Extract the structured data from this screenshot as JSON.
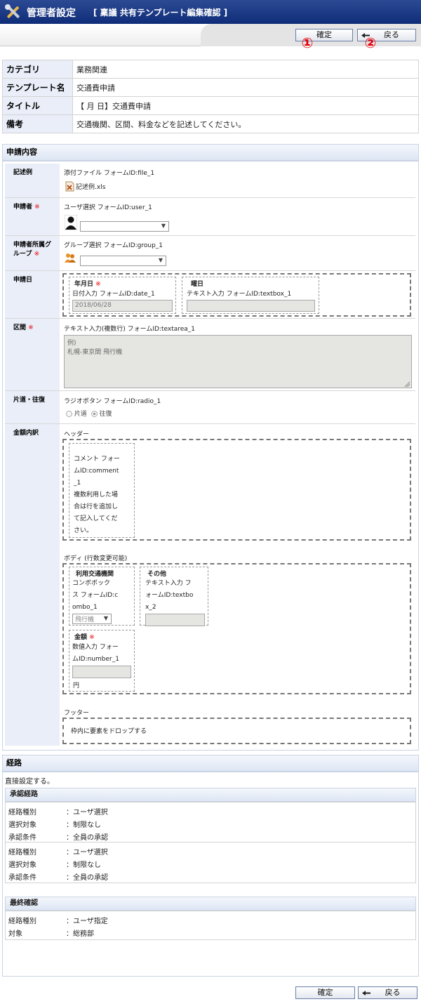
{
  "header": {
    "title": "管理者設定",
    "subtitle": "[ 稟議  共有テンプレート編集確認 ]"
  },
  "buttons": {
    "confirm": "確定",
    "back": "戻る"
  },
  "markers": {
    "one": "①",
    "two": "②"
  },
  "info": {
    "category_label": "カテゴリ",
    "category_value": "業務関連",
    "template_label": "テンプレート名",
    "template_value": "交通費申請",
    "title_label": "タイトル",
    "title_value": "【   月   日】交通費申請",
    "note_label": "備考",
    "note_value": "交通機関、区間、料金などを記述してください。"
  },
  "form": {
    "section_title": "申請内容",
    "required_mark": "※",
    "sample": {
      "label": "記述例",
      "desc": "添付ファイル フォームID:file_1",
      "file": "記述例.xls"
    },
    "applicant": {
      "label": "申請者",
      "desc": "ユーザ選択 フォームID:user_1"
    },
    "group": {
      "label_line1": "申請者所属グ",
      "label_line2": "ループ",
      "desc": "グループ選択 フォームID:group_1"
    },
    "date": {
      "label": "申請日",
      "ym_label": "年月日",
      "ym_desc": "日付入力 フォームID:date_1",
      "ym_value": "2018/06/28",
      "dow_label": "曜日",
      "dow_desc": "テキスト入力 フォームID:textbox_1"
    },
    "section": {
      "label": "区間",
      "desc": "テキスト入力(複数行)   フォームID:textarea_1",
      "text_line1": "例)",
      "text_line2": "札幌-東京間  飛行機"
    },
    "trip": {
      "label": "片道・往復",
      "desc": "ラジオボタン フォームID:radio_1",
      "opt1": "片道",
      "opt2": "往復"
    },
    "amount": {
      "label": "金額内訳",
      "header_label": "ヘッダー",
      "comment_lines": [
        "コメント フォー",
        "ムID:comment",
        "_1",
        "複数利用した場",
        "合は行を追加し",
        "て記入してくだ",
        "さい。"
      ],
      "body_label": "ボディ (行数変更可能)",
      "transport_label": "利用交通機関",
      "transport_lines": [
        "コンボボック",
        "ス フォームID:c",
        "ombo_1"
      ],
      "transport_value": "飛行機",
      "other_label": "その他",
      "other_lines": [
        "テキスト入力 フ",
        "ォームID:textbo",
        "x_2"
      ],
      "money_label": "金額",
      "money_lines": [
        "数値入力 フォー",
        "ムID:number_1"
      ],
      "money_unit": "円",
      "footer_label": "フッター",
      "drop_text": "枠内に要素をドロップする"
    }
  },
  "route": {
    "section_title": "経路",
    "direct": "直接設定する。",
    "approval_title": "承認経路",
    "approval": [
      {
        "type_label": "経路種別",
        "type_value": "：ユーザ選択",
        "target_label": "選択対象",
        "target_value": "：制限なし",
        "cond_label": "承認条件",
        "cond_value": "：全員の承認"
      },
      {
        "type_label": "経路種別",
        "type_value": "：ユーザ選択",
        "target_label": "選択対象",
        "target_value": "：制限なし",
        "cond_label": "承認条件",
        "cond_value": "：全員の承認"
      }
    ],
    "final_title": "最終確認",
    "final": {
      "type_label": "経路種別",
      "type_value": "：ユーザ指定",
      "target_label": "対象",
      "target_value": "：総務部"
    }
  },
  "colors": {
    "titlebar": "#1a3781",
    "label_bg": "#e9eef8",
    "required": "#e8000a"
  }
}
